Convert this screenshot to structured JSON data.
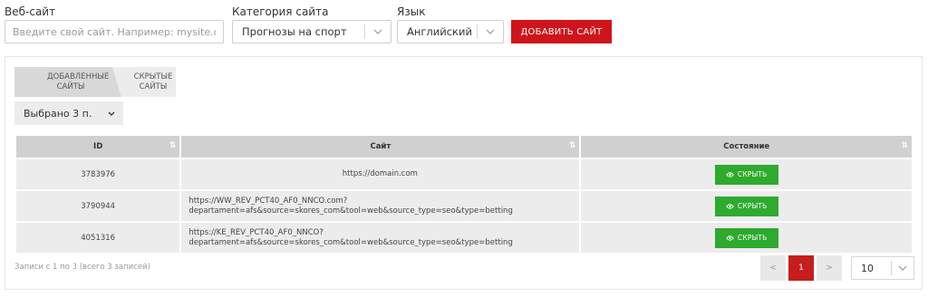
{
  "form": {
    "website_label": "Веб-сайт",
    "website_placeholder": "Введите свой сайт. Например: mysite.com",
    "category_label": "Категория сайта",
    "category_value": "Прогнозы на спорт",
    "language_label": "Язык",
    "language_value": "Английский",
    "add_button": "ДОБАВИТЬ САЙТ"
  },
  "tabs": {
    "added_line1": "ДОБАВЛЕННЫЕ",
    "added_line2": "САЙТЫ",
    "hidden_line1": "СКРЫТЫЕ",
    "hidden_line2": "САЙТЫ"
  },
  "selection": "Выбрано 3 п.",
  "table": {
    "headers": {
      "id": "ID",
      "site": "Сайт",
      "state": "Состояние"
    },
    "rows": [
      {
        "id": "3783976",
        "site_line1": "https://domain.com",
        "site_line2": "",
        "action": "СКРЫТЬ"
      },
      {
        "id": "3790944",
        "site_line1": "https://WW_REV_PCT40_AF0_NNCO.com?",
        "site_line2": "departament=afs&source=skores_com&tool=web&source_type=seo&type=betting",
        "action": "СКРЫТЬ"
      },
      {
        "id": "4051316",
        "site_line1": "https://KE_REV_PCT40_AF0_NNCO?",
        "site_line2": "departament=afs&source=skores_com&tool=web&source_type=seo&type=betting",
        "action": "СКРЫТЬ"
      }
    ]
  },
  "footer": {
    "info": "Записи с 1 по 3 (всего 3 записей)",
    "prev": "<",
    "current_page": "1",
    "next": ">",
    "per_page": "10"
  },
  "colors": {
    "accent": "#d0141b",
    "hide_button": "#2eaa2e"
  }
}
